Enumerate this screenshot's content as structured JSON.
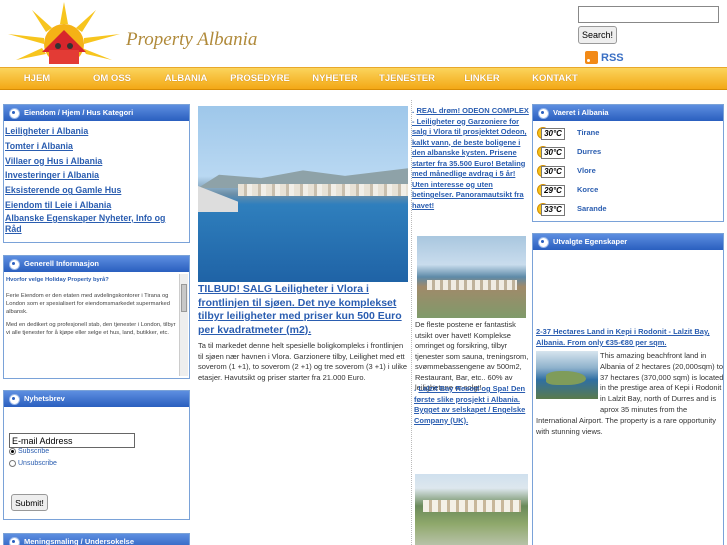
{
  "site": {
    "logo_text": "Property Albania",
    "search": {
      "value": "",
      "button": "Search!"
    },
    "rss": "RSS"
  },
  "nav": [
    "HJEM",
    "OM OSS",
    "ALBANIA",
    "PROSEDYRE",
    "NYHETER",
    "TJENESTER",
    "LINKER",
    "KONTAKT"
  ],
  "categories": {
    "title": "Eiendom / Hjem / Hus Kategori",
    "links": [
      "Leiligheter i Albania",
      "Tomter i Albania",
      "Villaer og Hus i Albania",
      "Investeringer i Albania",
      "Eksisterende og Gamle Hus",
      "Eiendom til Leie i Albania",
      "Albanske Egenskaper Nyheter, Info og Råd"
    ]
  },
  "general_info": {
    "title": "Generell Informasjon",
    "question": "Hvorfor velge Holiday Property byrå?",
    "p1": "Ferie Eiendom er den etaten med avdelingskontorer i Tirana og London som er spesialisert for eiendomsmarkedet supermarked albansk.",
    "p2": "Med en dedikert og profesjonell stab, den tjenester i London, tilbyr vi alle tjenester for å kjøpe eller selge et hus, land, butikker, etc."
  },
  "newsletter": {
    "title": "Nyhetsbrev",
    "email_value": "E-mail Address",
    "subscribe": "Subscribe",
    "unsubscribe": "Unsubscribe",
    "selected": "subscribe",
    "submit": "Submit!"
  },
  "survey": {
    "title": "Meningsmaling / Undersokelse"
  },
  "featured": {
    "title": "TILBUD! SALG Leiligheter i Vlora i frontlinjen til sjøen. Det nye komplekset tilbyr leiligheter med priser kun 500 Euro per kvadratmeter (m2).",
    "body": "Ta til markedet denne helt spesielle boligkompleks i frontlinjen til sjøen nær havnen i Vlora. Garzionere tilby, Leilighet med ett soverom (1 +1), to soverom (2 +1) og tre soverom (3 +1) i ulike etasjer. Havutsikt og priser starter fra 21.000 Euro."
  },
  "news": [
    {
      "link": "REAL drøm! ODEON COMPLEX - Leiligheter og Garzoniere for salg i Vlora til prosjektet Odeon, kalkt vann, de beste boligene i den albanske kysten. Prisene starter fra 35.500 Euro! Betaling med månedlige avdrag i 5 år! Uten interesse og uten betingelser. Panoramautsikt fra havet!",
      "body": "De fleste postene er fantastisk utsikt over havet! Komplekse omringet og forsikring, tilbyr tjenester som sauna, treningsrom, svømmebassengene av 500m2, Restaurant, Bar, etc.. 60% av leilighetene er solgt!"
    },
    {
      "link": "Lalzit Bay Resort og Spa! Den første slike prosjekt i Albania. Bygget av selskapet / Engelske Company (UK).",
      "body": ""
    }
  ],
  "weather": {
    "title": "Vaeret i Albania",
    "cities": [
      {
        "temp": "30°C",
        "city": "Tirane"
      },
      {
        "temp": "30°C",
        "city": "Durres"
      },
      {
        "temp": "30°C",
        "city": "Vlore"
      },
      {
        "temp": "29°C",
        "city": "Korce"
      },
      {
        "temp": "33°C",
        "city": "Sarande"
      }
    ]
  },
  "selected_properties": {
    "title": "Utvalgte Egenskaper",
    "item_title": "2-37 Hectares Land in Kepi i Rodonit - Lalzit Bay, Albania. From only €35-€80 per sqm.",
    "item_desc": "This amazing beachfront land in Albania of 2 hectares (20,000sqm) to 37 hectares (370,000 sqm) is located in the prestige area of Kepi i Rodonit in Lalzit Bay, north of Durres and is aprox 35 minutes from the International Airport. The property is a rare opportunity with stunning views."
  },
  "colors": {
    "nav_top": "#fbd45c",
    "nav_bottom": "#f3a816",
    "box_head": "#2a5fbf",
    "link": "#2a5db0"
  }
}
